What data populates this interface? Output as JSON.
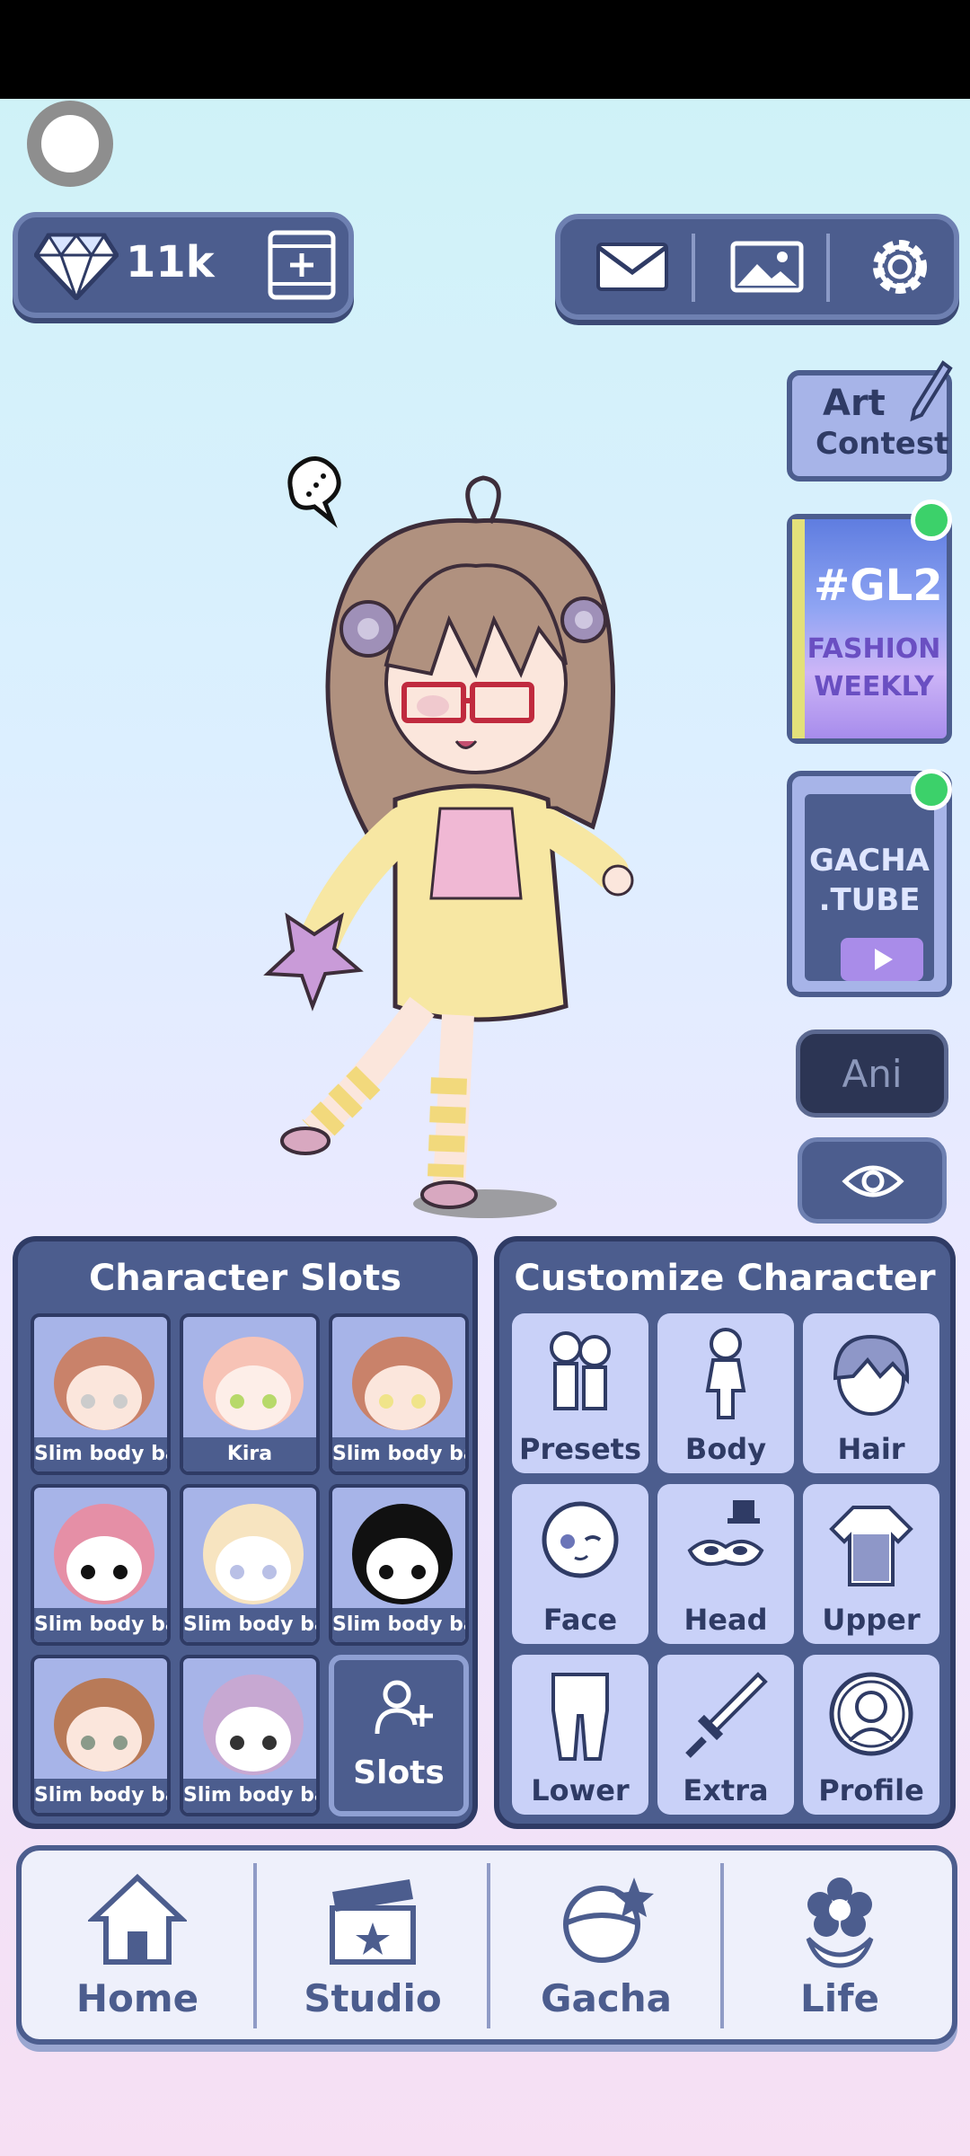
{
  "header": {
    "gems": "11k"
  },
  "side": {
    "art_contest": {
      "line1": "Art",
      "line2": "Contest"
    },
    "gl2": {
      "line1": "#GL2",
      "line2": "FASHION",
      "line3": "WEEKLY"
    },
    "gacha_tube": {
      "line1": "GACHA",
      "line2": ".TUBE"
    },
    "ani": "Ani"
  },
  "slots": {
    "title": "Character Slots",
    "items": [
      {
        "name": "Slim body bas"
      },
      {
        "name": "Kira"
      },
      {
        "name": "Slim body bas"
      },
      {
        "name": "Slim body bas"
      },
      {
        "name": "Slim body bas"
      },
      {
        "name": "Slim body bas"
      },
      {
        "name": "Slim body bas"
      },
      {
        "name": "Slim body bas"
      }
    ],
    "add_label": "Slots"
  },
  "customize": {
    "title": "Customize Character",
    "options": [
      {
        "label": "Presets"
      },
      {
        "label": "Body"
      },
      {
        "label": "Hair"
      },
      {
        "label": "Face"
      },
      {
        "label": "Head"
      },
      {
        "label": "Upper"
      },
      {
        "label": "Lower"
      },
      {
        "label": "Extra"
      },
      {
        "label": "Profile"
      }
    ]
  },
  "nav": {
    "items": [
      {
        "label": "Home"
      },
      {
        "label": "Studio"
      },
      {
        "label": "Gacha"
      },
      {
        "label": "Life"
      }
    ]
  },
  "colors": {
    "accent": "#4c5d8e",
    "panel_light": "#a7b4e8",
    "online_dot": "#3cd16a"
  }
}
